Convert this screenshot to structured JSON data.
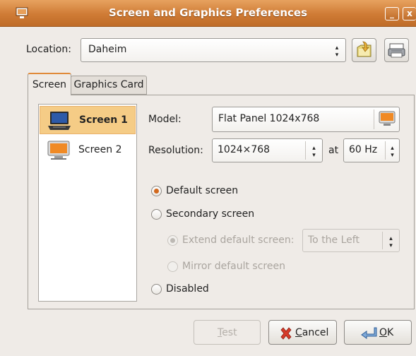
{
  "window": {
    "title": "Screen and Graphics Preferences",
    "minimize_glyph": "_",
    "close_glyph": "x"
  },
  "location": {
    "label": "Location:",
    "value": "Daheim"
  },
  "tabs": [
    {
      "label": "Screen",
      "active": true
    },
    {
      "label": "Graphics Card",
      "active": false
    }
  ],
  "screens": [
    {
      "label": "Screen 1",
      "selected": true
    },
    {
      "label": "Screen 2",
      "selected": false
    }
  ],
  "model": {
    "label": "Model:",
    "value": "Flat Panel 1024x768"
  },
  "resolution": {
    "label": "Resolution:",
    "value": "1024×768",
    "at_label": "at",
    "rate": "60 Hz"
  },
  "options": {
    "default": {
      "label": "Default screen",
      "checked": true
    },
    "secondary": {
      "label": "Secondary screen",
      "checked": false
    },
    "extend": {
      "label": "Extend default screen:",
      "checked": true,
      "enabled": false,
      "value": "To the Left"
    },
    "mirror": {
      "label": "Mirror default screen",
      "checked": false,
      "enabled": false
    },
    "disabled": {
      "label": "Disabled",
      "checked": false
    }
  },
  "buttons": {
    "test": {
      "mnemonic": "T",
      "rest": "est",
      "enabled": false
    },
    "cancel": {
      "mnemonic": "C",
      "rest": "ancel"
    },
    "ok": {
      "mnemonic": "O",
      "rest": "K"
    }
  },
  "colors": {
    "titlebar": "#cf7b35",
    "selection": "#f5cc86",
    "radio_dot": "#d2691e"
  }
}
